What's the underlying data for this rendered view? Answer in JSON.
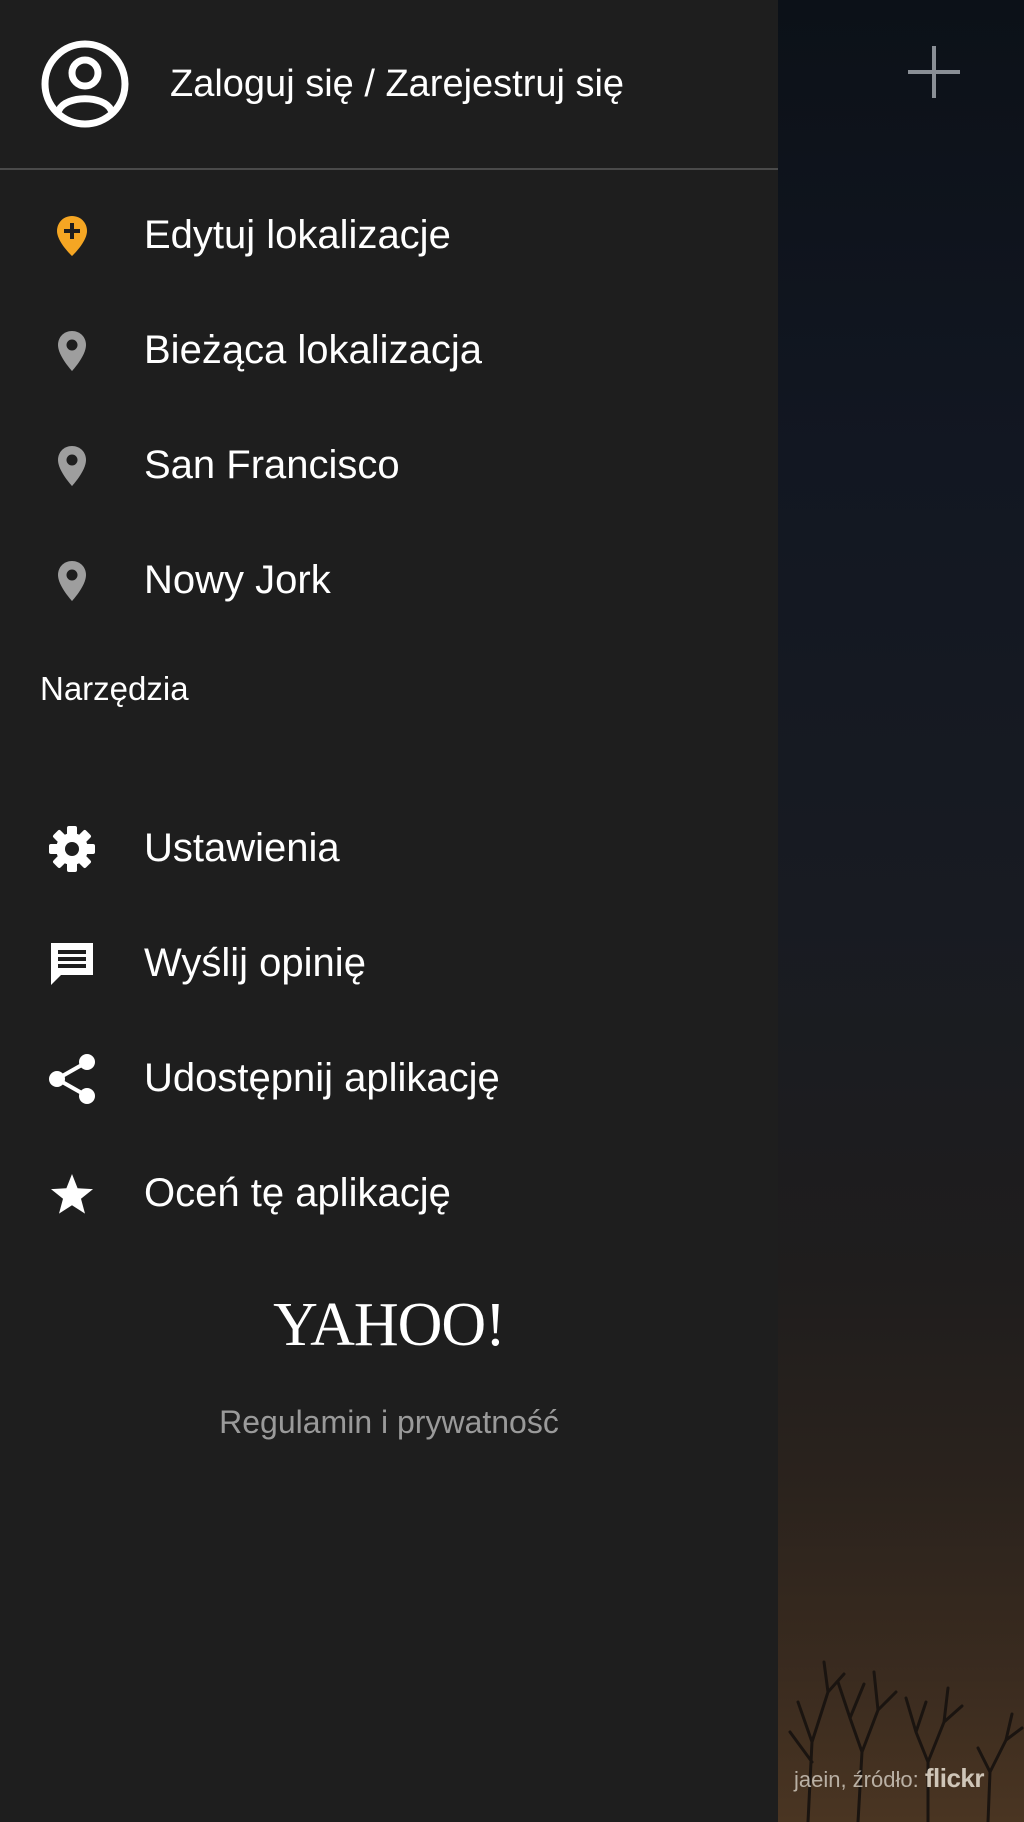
{
  "header": {
    "sign_in_label": "Zaloguj się / Zarejestruj się",
    "avatar_icon": "account-circle-icon"
  },
  "locations": {
    "items": [
      {
        "label": "Edytuj lokalizacje",
        "icon": "add-location-icon",
        "icon_color": "#f5a623"
      },
      {
        "label": "Bieżąca lokalizacja",
        "icon": "location-pin-icon",
        "icon_color": "#9e9e9e"
      },
      {
        "label": "San Francisco",
        "icon": "location-pin-icon",
        "icon_color": "#9e9e9e"
      },
      {
        "label": "Nowy Jork",
        "icon": "location-pin-icon",
        "icon_color": "#9e9e9e"
      }
    ]
  },
  "tools": {
    "section_title": "Narzędzia",
    "items": [
      {
        "label": "Ustawienia",
        "icon": "gear-icon"
      },
      {
        "label": "Wyślij opinię",
        "icon": "feedback-icon"
      },
      {
        "label": "Udostępnij aplikację",
        "icon": "share-icon"
      },
      {
        "label": "Oceń tę aplikację",
        "icon": "star-icon"
      }
    ]
  },
  "footer": {
    "logo_text": "YAHOO!",
    "terms_label": "Regulamin i prywatność"
  },
  "background": {
    "photo_credit_prefix": "jaein, źródło:",
    "photo_credit_source": "flickr",
    "add_icon": "plus-icon"
  },
  "colors": {
    "drawer_bg": "#1e1e1e",
    "accent": "#f5a623",
    "divider": "#4a4a4a",
    "muted_text": "#9a9a9a"
  }
}
